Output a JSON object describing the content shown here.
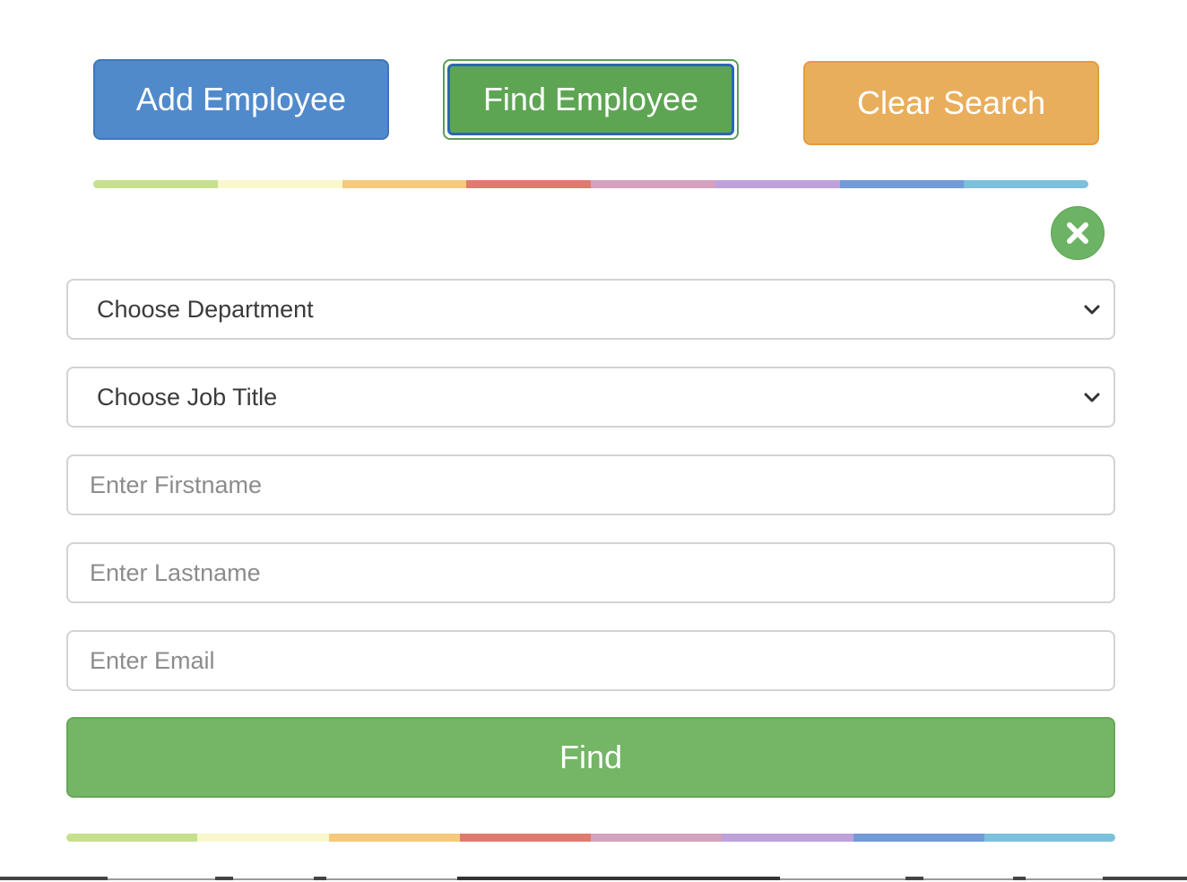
{
  "actions": {
    "add_employee": "Add Employee",
    "find_employee": "Find Employee",
    "clear_search": "Clear Search"
  },
  "rainbow_colors": [
    "#c6e08c",
    "#f8f8cc",
    "#f6c97c",
    "#e17a6e",
    "#d4a2be",
    "#bea1db",
    "#729bd8",
    "#7bc1dc"
  ],
  "close_icon": "close-x-icon",
  "form": {
    "department": {
      "selected": "Choose Department"
    },
    "job_title": {
      "selected": "Choose Job Title"
    },
    "firstname": {
      "value": "",
      "placeholder": "Enter Firstname"
    },
    "lastname": {
      "value": "",
      "placeholder": "Enter Lastname"
    },
    "email": {
      "value": "",
      "placeholder": "Enter Email"
    },
    "submit_label": "Find"
  },
  "colors": {
    "primary": "#518acb",
    "success": "#74b566",
    "warning": "#e9ae5c"
  }
}
